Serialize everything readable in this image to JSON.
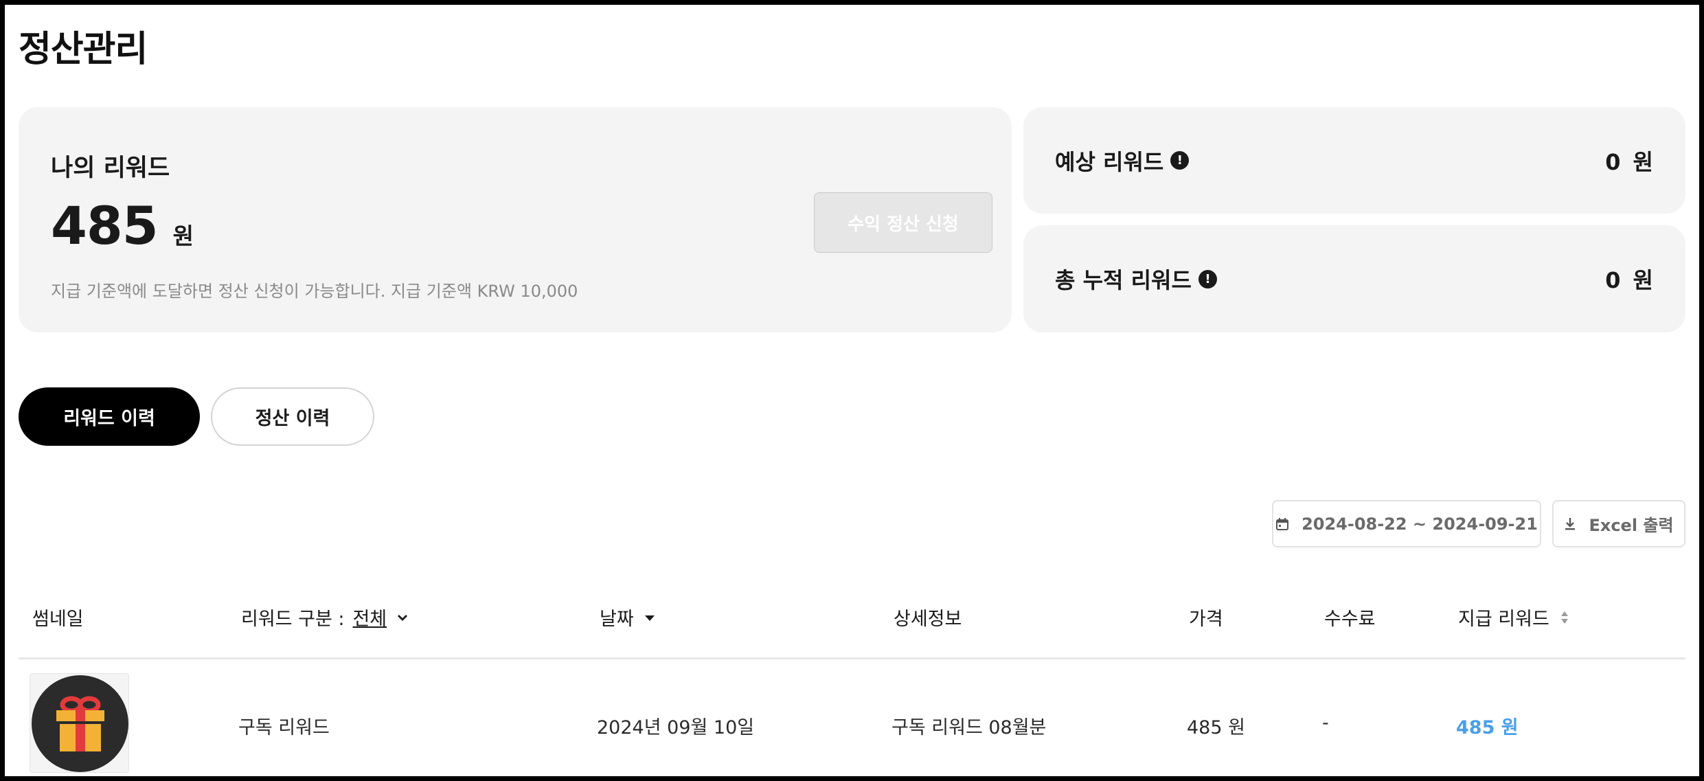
{
  "page": {
    "title": "정산관리"
  },
  "my_reward": {
    "label": "나의 리워드",
    "amount": "485",
    "unit": "원",
    "note": "지급 기준액에 도달하면 정산 신청이 가능합니다. 지급 기준액 KRW 10,000",
    "settle_button": "수익 정산 신청"
  },
  "expected_reward": {
    "label": "예상 리워드",
    "value": "0",
    "unit": "원"
  },
  "total_reward": {
    "label": "총 누적 리워드",
    "value": "0",
    "unit": "원"
  },
  "tabs": [
    {
      "label": "리워드 이력",
      "active": true
    },
    {
      "label": "정산 이력",
      "active": false
    }
  ],
  "toolbar": {
    "date_range": "2024-08-22 ~ 2024-09-21",
    "excel_label": "Excel 출력"
  },
  "table": {
    "headers": {
      "thumbnail": "썸네일",
      "type": "리워드 구분 :",
      "type_filter": "전체",
      "date": "날짜",
      "detail": "상세정보",
      "price": "가격",
      "fee": "수수료",
      "payout": "지급 리워드"
    },
    "rows": [
      {
        "thumbnail_icon": "gift-icon",
        "type": "구독 리워드",
        "date": "2024년 09월 10일",
        "detail": "구독 리워드 08월분",
        "price": "485 원",
        "fee": "-",
        "payout": "485 원"
      }
    ]
  },
  "colors": {
    "primary_dark": "#000000",
    "card_bg": "#f4f4f4",
    "payout_blue": "#4a9fe8",
    "muted_text": "#8a8a8a"
  }
}
